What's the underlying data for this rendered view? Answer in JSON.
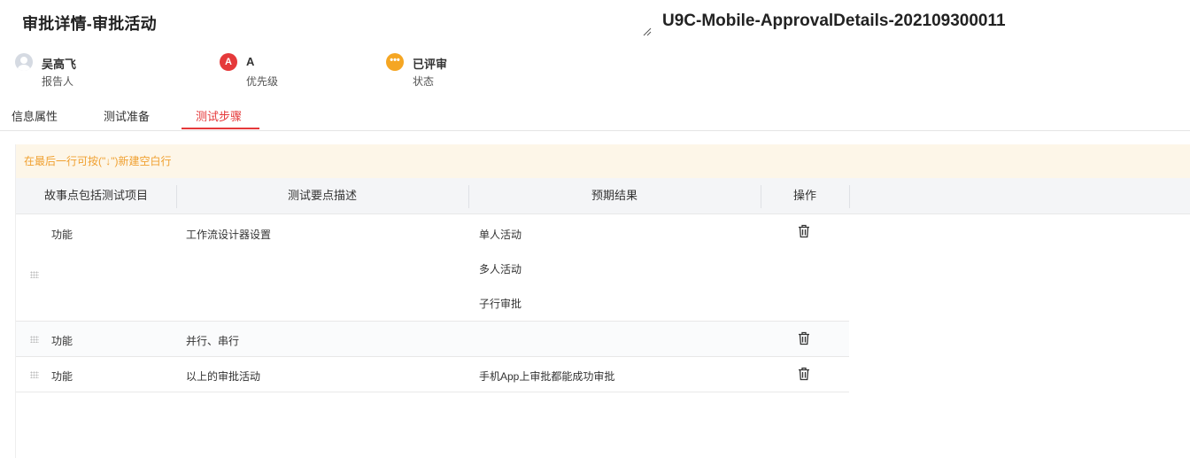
{
  "header": {
    "title": "审批详情-审批活动",
    "doc_code": "U9C-Mobile-ApprovalDetails-202109300011"
  },
  "meta": {
    "reporter": {
      "value": "吴高飞",
      "label": "报告人"
    },
    "priority": {
      "icon_text": "A",
      "value": "A",
      "label": "优先级"
    },
    "status": {
      "icon_text": "•••",
      "value": "已评审",
      "label": "状态"
    }
  },
  "tabs": [
    {
      "label": "信息属性",
      "active": false
    },
    {
      "label": "测试准备",
      "active": false
    },
    {
      "label": "测试步骤",
      "active": true
    }
  ],
  "hint": "在最后一行可按(\"↓\")新建空白行",
  "table": {
    "columns": [
      "故事点包括测试项目",
      "测试要点描述",
      "预期结果",
      "操作"
    ],
    "rows": [
      {
        "item": "功能",
        "desc": "工作流设计器设置",
        "results": [
          "单人活动",
          "多人活动",
          "子行审批"
        ]
      },
      {
        "item": "功能",
        "desc": "并行、串行",
        "results": [
          ""
        ]
      },
      {
        "item": "功能",
        "desc": "以上的审批活动",
        "results": [
          "手机App上审批都能成功审批"
        ]
      }
    ]
  },
  "colors": {
    "accent": "#e5393a",
    "warning": "#f5a623",
    "hint_bg": "#fdf6e8",
    "hint_text": "#f0a030"
  },
  "icons": {
    "delete": "trash-icon",
    "drag": "drag-handle-icon",
    "avatar": "user-avatar-icon"
  }
}
